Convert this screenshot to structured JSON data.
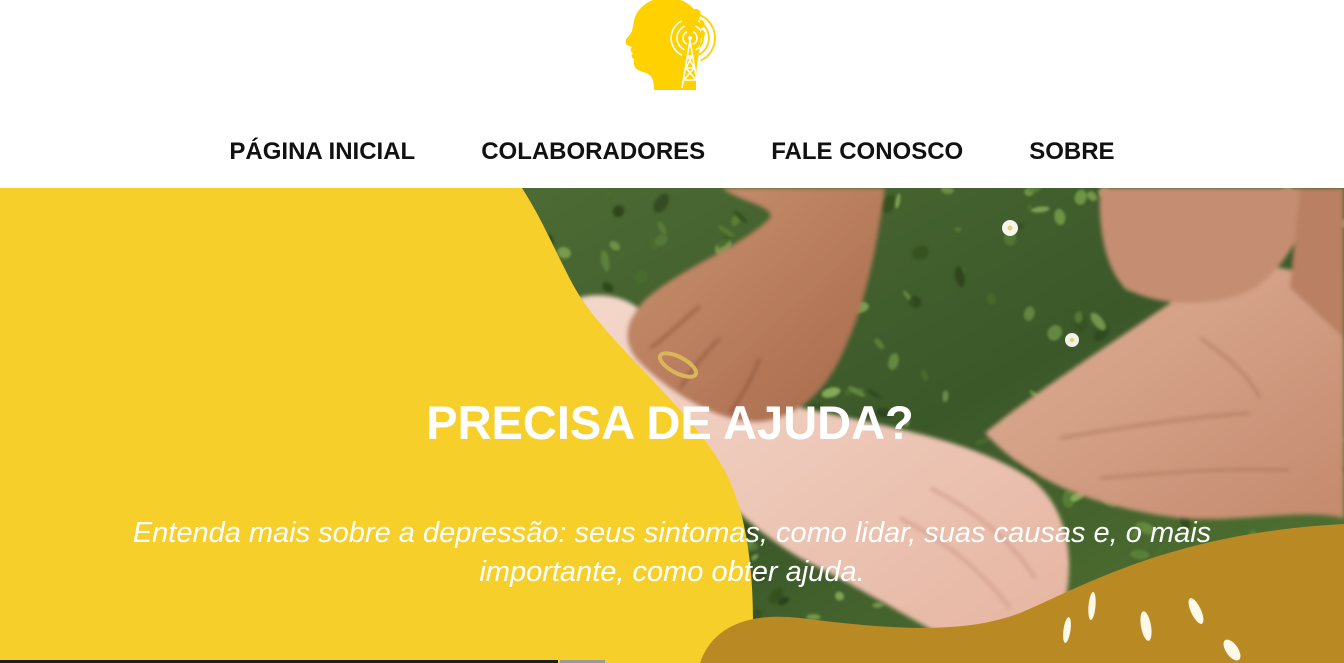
{
  "colors": {
    "brand_yellow": "#FFD100",
    "hero_yellow": "#F7CF2B",
    "accent_gold": "#B98A24",
    "nav_text": "#111111",
    "hero_text": "#FFFFFF"
  },
  "header": {
    "logo_icon": "head-radio-tower-logo-icon"
  },
  "nav": {
    "items": [
      {
        "label": "PÁGINA INICIAL"
      },
      {
        "label": "COLABORADORES"
      },
      {
        "label": "FALE CONOSCO"
      },
      {
        "label": "SOBRE"
      }
    ]
  },
  "hero": {
    "image_icon": "hands-holding-wrists-photo",
    "title": "PRECISA DE AJUDA?",
    "subtitle": "Entenda mais sobre a depressão: seus sintomas, como lidar, suas causas e, o mais importante, como obter ajuda."
  }
}
